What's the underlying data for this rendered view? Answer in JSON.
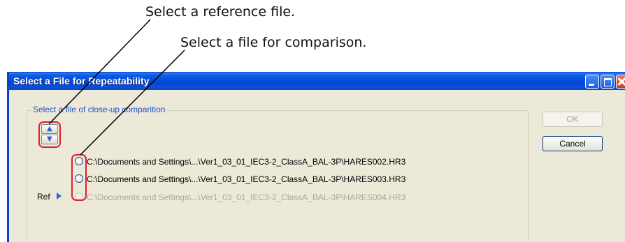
{
  "annotations": {
    "reference_callout": "Select a reference file.",
    "comparison_callout": "Select a file for comparison."
  },
  "window": {
    "title": "Select a File for Repeatability",
    "titlebar_color": "#0546d6",
    "face_color": "#ece9d8",
    "controls": [
      "minimize-icon",
      "maximize-icon",
      "close-icon"
    ]
  },
  "group": {
    "legend": "Select a file of close-up comparition",
    "legend_color": "#2150c8"
  },
  "reorder": {
    "up_icon": "up-arrow-icon",
    "down_icon": "down-arrow-icon",
    "up_glyph": "▲",
    "down_glyph": "▼"
  },
  "files": [
    {
      "path": "C:\\Documents and Settings\\...\\Ver1_03_01_IEC3-2_ClassA_BAL-3P\\HARES002.HR3",
      "enabled": true
    },
    {
      "path": "C:\\Documents and Settings\\...\\Ver1_03_01_IEC3-2_ClassA_BAL-3P\\HARES003.HR3",
      "enabled": true
    },
    {
      "path": "C:\\Documents and Settings\\...\\Ver1_03_01_IEC3-2_ClassA_BAL-3P\\HARES004.HR3",
      "enabled": false
    }
  ],
  "ref_marker": {
    "label": "Ref",
    "icon": "triangle-right-icon"
  },
  "buttons": {
    "ok": "OK",
    "ok_enabled": false,
    "cancel": "Cancel"
  },
  "highlight_color": "#e0202a"
}
